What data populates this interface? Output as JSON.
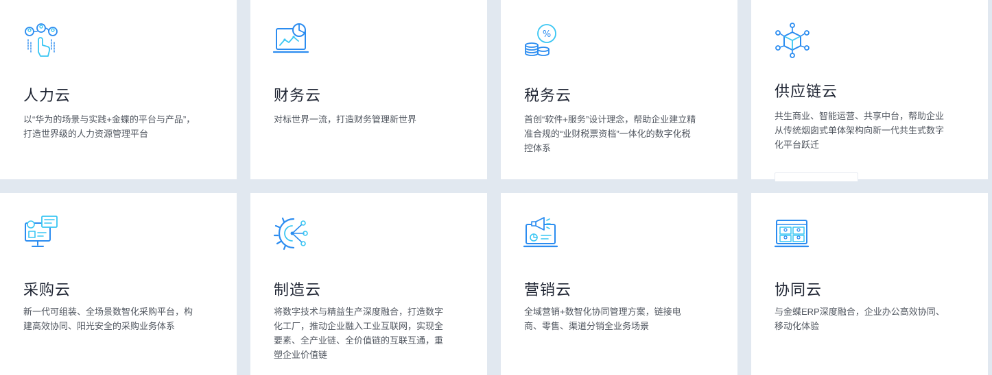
{
  "colors": {
    "accent": "#2b8cf0",
    "accent_light": "#39c6f3",
    "background": "#e1e8f0",
    "card": "#ffffff"
  },
  "cards": [
    {
      "icon": "people-network-icon",
      "title": "人力云",
      "desc": "以“华为的场景与实践+金蝶的平台与产品”，打造世界级的人力资源管理平台"
    },
    {
      "icon": "finance-monitor-icon",
      "title": "财务云",
      "desc": "对标世界一流，打造财务管理新世界"
    },
    {
      "icon": "tax-coins-icon",
      "title": "税务云",
      "desc": "首创“软件+服务”设计理念，帮助企业建立精准合规的“业财税票资档”一体化的数字化税控体系"
    },
    {
      "icon": "supply-chain-cube-icon",
      "title": "供应链云",
      "desc": "共生商业、智能运营、共享中台，帮助企业从传统烟囱式单体架构向新一代共生式数字化平台跃迁"
    },
    {
      "icon": "procurement-screens-icon",
      "title": "采购云",
      "desc": "新一代可组装、全场景数智化采购平台，构建高效协同、阳光安全的采购业务体系"
    },
    {
      "icon": "manufacturing-gear-icon",
      "title": "制造云",
      "desc": "将数字技术与精益生产深度融合，打造数字化工厂，推动企业融入工业互联网，实现全要素、全产业链、全价值链的互联互通，重塑企业价值链"
    },
    {
      "icon": "marketing-megaphone-icon",
      "title": "营销云",
      "desc": "全域营销+数智化协同管理方案，链接电商、零售、渠道分销全业务场景"
    },
    {
      "icon": "collaboration-video-icon",
      "title": "协同云",
      "desc": "与金蝶ERP深度融合，企业办公高效协同、移动化体验"
    }
  ]
}
